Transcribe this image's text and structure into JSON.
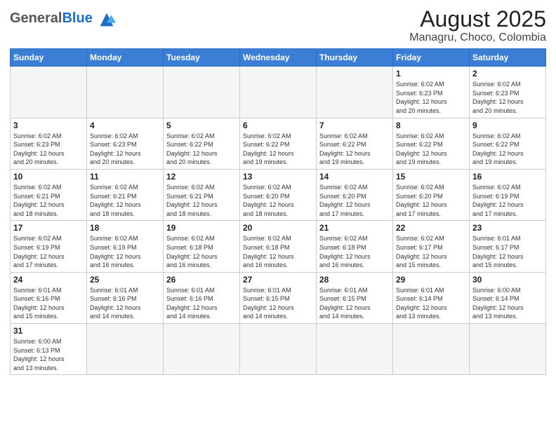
{
  "logo": {
    "text_general": "General",
    "text_blue": "Blue"
  },
  "header": {
    "title": "August 2025",
    "subtitle": "Managru, Choco, Colombia"
  },
  "weekdays": [
    "Sunday",
    "Monday",
    "Tuesday",
    "Wednesday",
    "Thursday",
    "Friday",
    "Saturday"
  ],
  "weeks": [
    [
      {
        "day": "",
        "info": "",
        "empty": true
      },
      {
        "day": "",
        "info": "",
        "empty": true
      },
      {
        "day": "",
        "info": "",
        "empty": true
      },
      {
        "day": "",
        "info": "",
        "empty": true
      },
      {
        "day": "",
        "info": "",
        "empty": true
      },
      {
        "day": "1",
        "info": "Sunrise: 6:02 AM\nSunset: 6:23 PM\nDaylight: 12 hours\nand 20 minutes."
      },
      {
        "day": "2",
        "info": "Sunrise: 6:02 AM\nSunset: 6:23 PM\nDaylight: 12 hours\nand 20 minutes."
      }
    ],
    [
      {
        "day": "3",
        "info": "Sunrise: 6:02 AM\nSunset: 6:23 PM\nDaylight: 12 hours\nand 20 minutes."
      },
      {
        "day": "4",
        "info": "Sunrise: 6:02 AM\nSunset: 6:23 PM\nDaylight: 12 hours\nand 20 minutes."
      },
      {
        "day": "5",
        "info": "Sunrise: 6:02 AM\nSunset: 6:22 PM\nDaylight: 12 hours\nand 20 minutes."
      },
      {
        "day": "6",
        "info": "Sunrise: 6:02 AM\nSunset: 6:22 PM\nDaylight: 12 hours\nand 19 minutes."
      },
      {
        "day": "7",
        "info": "Sunrise: 6:02 AM\nSunset: 6:22 PM\nDaylight: 12 hours\nand 19 minutes."
      },
      {
        "day": "8",
        "info": "Sunrise: 6:02 AM\nSunset: 6:22 PM\nDaylight: 12 hours\nand 19 minutes."
      },
      {
        "day": "9",
        "info": "Sunrise: 6:02 AM\nSunset: 6:22 PM\nDaylight: 12 hours\nand 19 minutes."
      }
    ],
    [
      {
        "day": "10",
        "info": "Sunrise: 6:02 AM\nSunset: 6:21 PM\nDaylight: 12 hours\nand 18 minutes."
      },
      {
        "day": "11",
        "info": "Sunrise: 6:02 AM\nSunset: 6:21 PM\nDaylight: 12 hours\nand 18 minutes."
      },
      {
        "day": "12",
        "info": "Sunrise: 6:02 AM\nSunset: 6:21 PM\nDaylight: 12 hours\nand 18 minutes."
      },
      {
        "day": "13",
        "info": "Sunrise: 6:02 AM\nSunset: 6:20 PM\nDaylight: 12 hours\nand 18 minutes."
      },
      {
        "day": "14",
        "info": "Sunrise: 6:02 AM\nSunset: 6:20 PM\nDaylight: 12 hours\nand 17 minutes."
      },
      {
        "day": "15",
        "info": "Sunrise: 6:02 AM\nSunset: 6:20 PM\nDaylight: 12 hours\nand 17 minutes."
      },
      {
        "day": "16",
        "info": "Sunrise: 6:02 AM\nSunset: 6:19 PM\nDaylight: 12 hours\nand 17 minutes."
      }
    ],
    [
      {
        "day": "17",
        "info": "Sunrise: 6:02 AM\nSunset: 6:19 PM\nDaylight: 12 hours\nand 17 minutes."
      },
      {
        "day": "18",
        "info": "Sunrise: 6:02 AM\nSunset: 6:19 PM\nDaylight: 12 hours\nand 16 minutes."
      },
      {
        "day": "19",
        "info": "Sunrise: 6:02 AM\nSunset: 6:18 PM\nDaylight: 12 hours\nand 16 minutes."
      },
      {
        "day": "20",
        "info": "Sunrise: 6:02 AM\nSunset: 6:18 PM\nDaylight: 12 hours\nand 16 minutes."
      },
      {
        "day": "21",
        "info": "Sunrise: 6:02 AM\nSunset: 6:18 PM\nDaylight: 12 hours\nand 16 minutes."
      },
      {
        "day": "22",
        "info": "Sunrise: 6:02 AM\nSunset: 6:17 PM\nDaylight: 12 hours\nand 15 minutes."
      },
      {
        "day": "23",
        "info": "Sunrise: 6:01 AM\nSunset: 6:17 PM\nDaylight: 12 hours\nand 15 minutes."
      }
    ],
    [
      {
        "day": "24",
        "info": "Sunrise: 6:01 AM\nSunset: 6:16 PM\nDaylight: 12 hours\nand 15 minutes."
      },
      {
        "day": "25",
        "info": "Sunrise: 6:01 AM\nSunset: 6:16 PM\nDaylight: 12 hours\nand 14 minutes."
      },
      {
        "day": "26",
        "info": "Sunrise: 6:01 AM\nSunset: 6:16 PM\nDaylight: 12 hours\nand 14 minutes."
      },
      {
        "day": "27",
        "info": "Sunrise: 6:01 AM\nSunset: 6:15 PM\nDaylight: 12 hours\nand 14 minutes."
      },
      {
        "day": "28",
        "info": "Sunrise: 6:01 AM\nSunset: 6:15 PM\nDaylight: 12 hours\nand 14 minutes."
      },
      {
        "day": "29",
        "info": "Sunrise: 6:01 AM\nSunset: 6:14 PM\nDaylight: 12 hours\nand 13 minutes."
      },
      {
        "day": "30",
        "info": "Sunrise: 6:00 AM\nSunset: 6:14 PM\nDaylight: 12 hours\nand 13 minutes."
      }
    ],
    [
      {
        "day": "31",
        "info": "Sunrise: 6:00 AM\nSunset: 6:13 PM\nDaylight: 12 hours\nand 13 minutes."
      },
      {
        "day": "",
        "info": "",
        "empty": true
      },
      {
        "day": "",
        "info": "",
        "empty": true
      },
      {
        "day": "",
        "info": "",
        "empty": true
      },
      {
        "day": "",
        "info": "",
        "empty": true
      },
      {
        "day": "",
        "info": "",
        "empty": true
      },
      {
        "day": "",
        "info": "",
        "empty": true
      }
    ]
  ]
}
